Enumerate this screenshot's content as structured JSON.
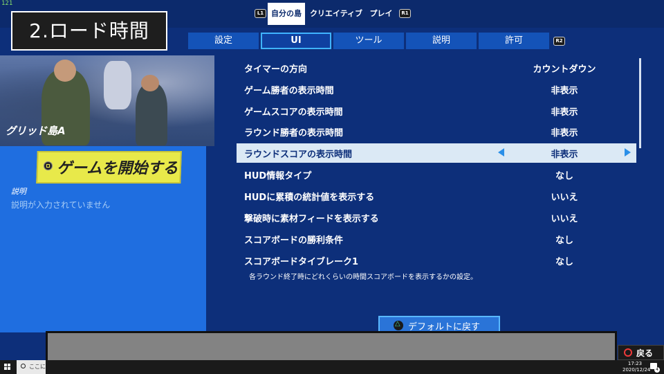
{
  "overlay": {
    "title": "2.ロード時間"
  },
  "debug": {
    "fps": "121"
  },
  "top_nav": {
    "left_button": "L1",
    "right_button": "R1",
    "tabs": [
      "自分の島",
      "クリエイティブ",
      "プレイ"
    ],
    "active_tab": "自分の島"
  },
  "settings_tabs": {
    "tabs": [
      "設定",
      "UI",
      "ツール",
      "説明",
      "許可"
    ],
    "active_tab": "UI",
    "right_button": "R2"
  },
  "island": {
    "name": "グリッド島A",
    "start_button": "ゲームを開始する",
    "description_label": "説明",
    "description_value": "説明が入力されていません"
  },
  "settings_rows": [
    {
      "label": "タイマーの方向",
      "value": "カウントダウン"
    },
    {
      "label": "ゲーム勝者の表示時間",
      "value": "非表示"
    },
    {
      "label": "ゲームスコアの表示時間",
      "value": "非表示"
    },
    {
      "label": "ラウンド勝者の表示時間",
      "value": "非表示"
    },
    {
      "label": "ラウンドスコアの表示時間",
      "value": "非表示"
    },
    {
      "label": "HUD情報タイプ",
      "value": "なし"
    },
    {
      "label": "HUDに累積の統計値を表示する",
      "value": "いいえ"
    },
    {
      "label": "撃破時に素材フィードを表示する",
      "value": "いいえ"
    },
    {
      "label": "スコアボードの勝利条件",
      "value": "なし"
    },
    {
      "label": "スコアボードタイブレーク1",
      "value": "なし"
    }
  ],
  "selected_row_index": 4,
  "help_text": "各ラウンド終了時にどれくらいの時間スコアボードを表示するかの設定。",
  "default_button": "デフォルトに戻す",
  "back_button": "戻る",
  "taskbar": {
    "search_placeholder": "ここに入",
    "time": "17:23",
    "date": "2020/12/24",
    "notification_count": "4"
  }
}
